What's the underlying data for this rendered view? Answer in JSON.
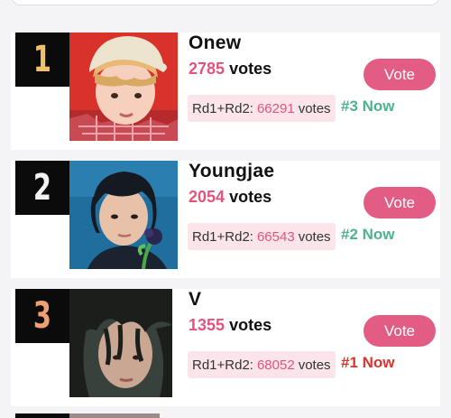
{
  "colors": {
    "accent_pink": "#e2547c",
    "vote_button": "#e35c84",
    "round_box_bg": "#fbe5ea",
    "rank_box_bg": "#0b0b0b",
    "now_green": "#4db38c",
    "now_red": "#e0322c"
  },
  "ranking": [
    {
      "rank": "1",
      "rank_color": "#f1c06a",
      "name": "Onew",
      "votes": "2785",
      "votes_suffix": "votes",
      "vote_button_label": "Vote",
      "round_prefix": "Rd1+Rd2:",
      "round_total": "66291",
      "round_suffix": "votes",
      "now_rank": "#3 Now",
      "now_color": "#4db38c"
    },
    {
      "rank": "2",
      "rank_color": "#f2f2f2",
      "name": "Youngjae",
      "votes": "2054",
      "votes_suffix": "votes",
      "vote_button_label": "Vote",
      "round_prefix": "Rd1+Rd2:",
      "round_total": "66543",
      "round_suffix": "votes",
      "now_rank": "#2 Now",
      "now_color": "#4db38c"
    },
    {
      "rank": "3",
      "rank_color": "#f0a070",
      "name": "V",
      "votes": "1355",
      "votes_suffix": "votes",
      "vote_button_label": "Vote",
      "round_prefix": "Rd1+Rd2:",
      "round_total": "68052",
      "round_suffix": "votes",
      "now_rank": "#1 Now",
      "now_color": "#e0322c"
    }
  ]
}
